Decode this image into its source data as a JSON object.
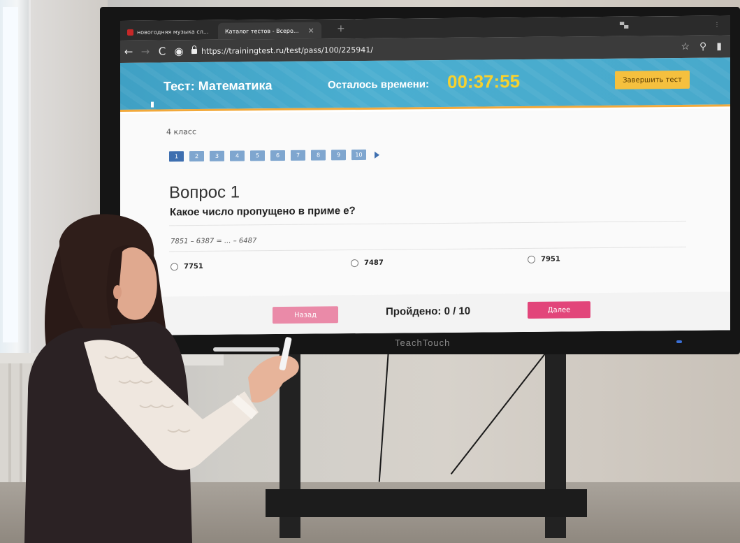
{
  "browser": {
    "tabs": [
      {
        "label": "новогодняя музыка сл...",
        "active": false
      },
      {
        "label": "Каталог тестов - Всеро...",
        "active": true
      }
    ],
    "url": "https://trainingtest.ru/test/pass/100/225941/"
  },
  "header": {
    "title": "Тест: Математика",
    "time_label": "Осталось времени:",
    "time_value": "00:37:55",
    "finish_label": "Завершить тест"
  },
  "test": {
    "grade": "4 класс",
    "pages": [
      "1",
      "2",
      "3",
      "4",
      "5",
      "6",
      "7",
      "8",
      "9",
      "10"
    ],
    "current_page": "1",
    "question_number": "Вопрос 1",
    "question_text": "Какое число пропущено в приме  е?",
    "example": "7851 – 6387 = ... – 6487",
    "answers": [
      "7751",
      "7487",
      "7951"
    ]
  },
  "footer": {
    "back_label": "Назад",
    "progress": "Пройдено: 0 / 10",
    "next_label": "Далее"
  },
  "device": {
    "brand": "TeachTouch"
  },
  "colors": {
    "header_bg": "#48a9cc",
    "timer": "#f6d12f",
    "finish_button": "#f5c03e",
    "page_current": "#3e6fb0",
    "page_other": "#7fa6cf",
    "next_button": "#e2457a",
    "back_button": "#ea8aa8"
  }
}
